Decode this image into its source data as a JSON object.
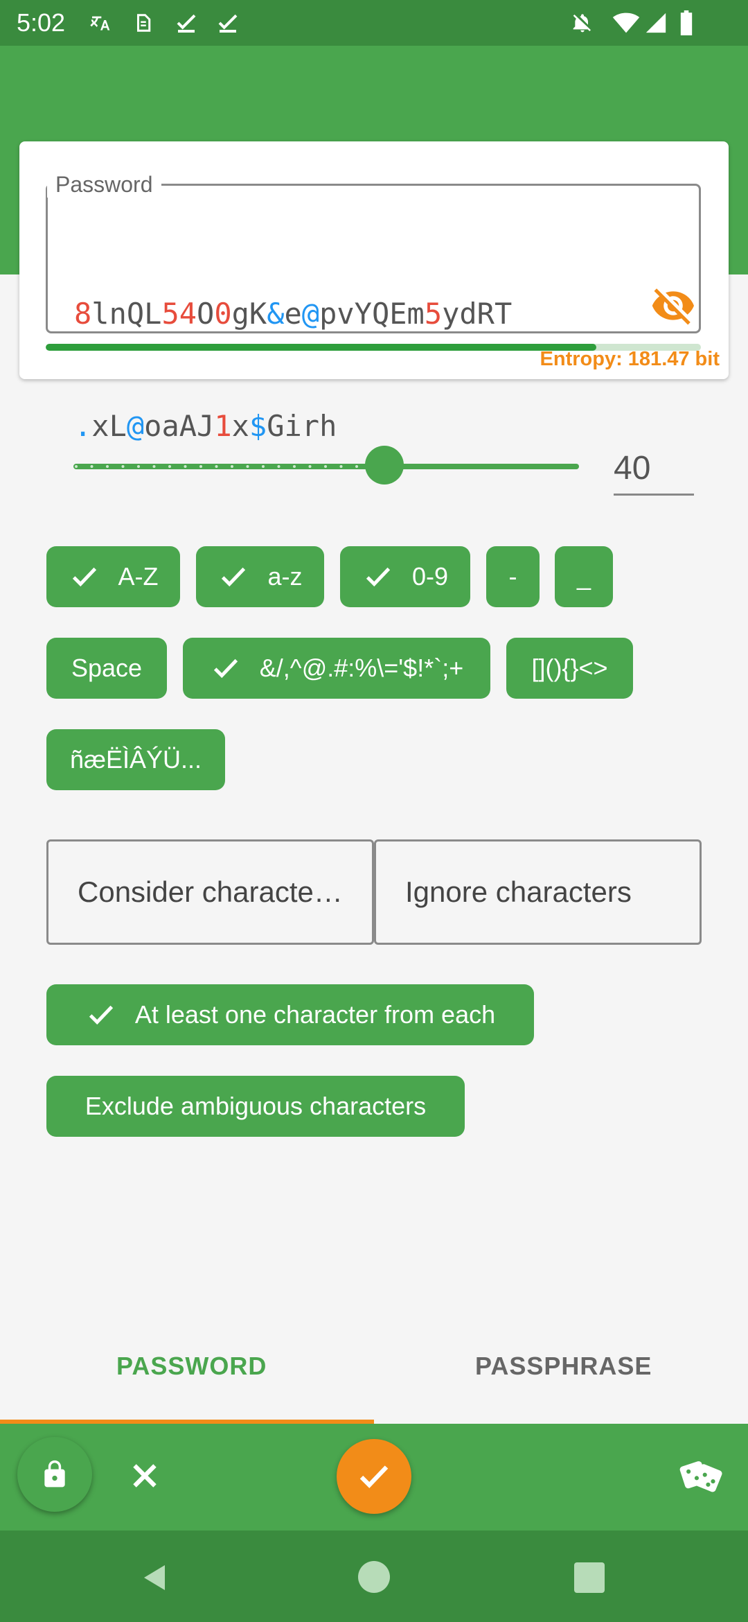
{
  "status_bar": {
    "time": "5:02",
    "left_icons": [
      "translate-icon",
      "sim-icon",
      "check-icon",
      "check-icon"
    ],
    "right_icons": [
      "notifications-off-icon",
      "wifi-icon",
      "signal-icon",
      "battery-icon"
    ]
  },
  "password_card": {
    "label": "Password",
    "line1": [
      {
        "t": "8",
        "c": "r"
      },
      {
        "t": "lnQL",
        "c": ""
      },
      {
        "t": "54",
        "c": "r"
      },
      {
        "t": "O",
        "c": ""
      },
      {
        "t": "0",
        "c": "r"
      },
      {
        "t": "gK",
        "c": ""
      },
      {
        "t": "&",
        "c": "b"
      },
      {
        "t": "e",
        "c": ""
      },
      {
        "t": "@",
        "c": "b"
      },
      {
        "t": "pvYQEm",
        "c": ""
      },
      {
        "t": "5",
        "c": "r"
      },
      {
        "t": "ydRT",
        "c": ""
      }
    ],
    "line2": [
      {
        "t": ".",
        "c": "b"
      },
      {
        "t": "xL",
        "c": ""
      },
      {
        "t": "@",
        "c": "b"
      },
      {
        "t": "oaAJ",
        "c": ""
      },
      {
        "t": "1",
        "c": "r"
      },
      {
        "t": "x",
        "c": ""
      },
      {
        "t": "$",
        "c": "b"
      },
      {
        "t": "Girh",
        "c": ""
      }
    ],
    "entropy": "Entropy: 181.47 bit",
    "strength_fraction": 0.84,
    "visibility_icon": "visibility-off-icon"
  },
  "length": {
    "value": "40",
    "slider_fraction": 0.62
  },
  "char_chips": [
    {
      "label": "A-Z",
      "checked": true
    },
    {
      "label": "a-z",
      "checked": true
    },
    {
      "label": "0-9",
      "checked": true
    },
    {
      "label": "-",
      "checked": false
    },
    {
      "label": "_",
      "checked": false
    },
    {
      "label": "Space",
      "checked": false
    },
    {
      "label": "&/,^@.#:%\\='$!*`;+",
      "checked": true
    },
    {
      "label": "[](){}<>",
      "checked": false
    },
    {
      "label": "ñæËÌÂÝÜ...",
      "checked": false
    }
  ],
  "consider_button": "Consider characte…",
  "ignore_button": "Ignore characters",
  "option_chips": [
    {
      "label": "At least one character from each",
      "checked": true
    },
    {
      "label": "Exclude ambiguous characters",
      "checked": false
    }
  ],
  "tabs": [
    {
      "label": "PASSWORD",
      "active": true
    },
    {
      "label": "PASSPHRASE",
      "active": false
    }
  ],
  "colors": {
    "primary": "#4aa64e",
    "primary_dark": "#3a8b3e",
    "accent": "#f28c18",
    "digit_color": "#e74c3c",
    "symbol_color": "#2196f3"
  }
}
